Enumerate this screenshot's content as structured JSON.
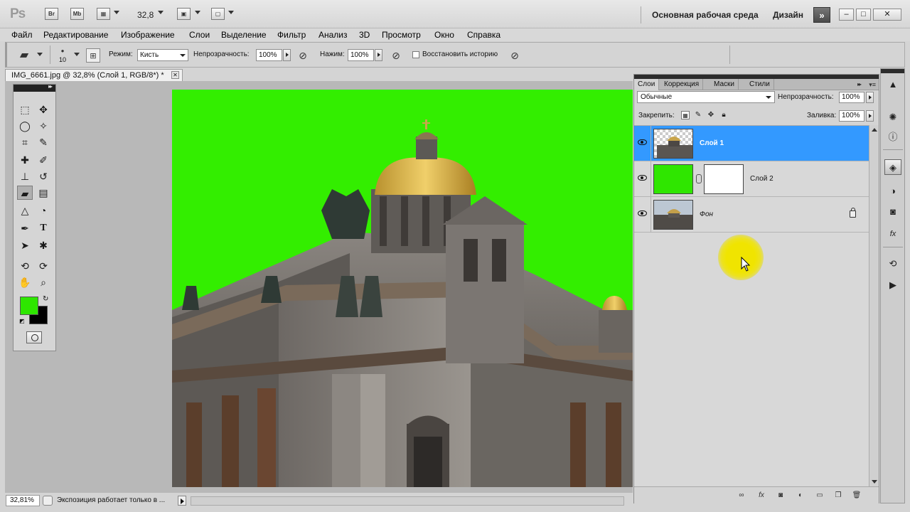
{
  "app": {
    "logo": "Ps",
    "bridge_btn": "Br",
    "minibridge_btn": "Mb",
    "zoom": "32,8",
    "workspace": "Основная рабочая среда",
    "design": "Дизайн",
    "more_btn": "»"
  },
  "window_controls": {
    "minimize": "–",
    "maximize": "□",
    "close": "✕"
  },
  "menu": [
    "Файл",
    "Редактирование",
    "Изображение",
    "Слои",
    "Выделение",
    "Фильтр",
    "Анализ",
    "3D",
    "Просмотр",
    "Окно",
    "Справка"
  ],
  "options": {
    "brush_size": "10",
    "mode_label": "Режим:",
    "mode_value": "Кисть",
    "opacity_label": "Непрозрачность:",
    "opacity_value": "100%",
    "flow_label": "Нажим:",
    "flow_value": "100%",
    "restore_history_label": "Восстановить историю",
    "restore_history_checked": false
  },
  "document": {
    "tab_title": "IMG_6661.jpg @ 32,8% (Слой 1, RGB/8*) *",
    "close": "✕",
    "background_color": "#33ee00"
  },
  "toolbox": {
    "foreground_color": "#2ee600",
    "background_color": "#000000",
    "tools": [
      {
        "name": "marquee-tool-icon",
        "glyph": "⬚"
      },
      {
        "name": "move-tool-icon",
        "glyph": "✥"
      },
      {
        "name": "lasso-tool-icon",
        "glyph": "◯"
      },
      {
        "name": "magic-wand-tool-icon",
        "glyph": "✧"
      },
      {
        "name": "crop-tool-icon",
        "glyph": "⌗"
      },
      {
        "name": "eyedropper-tool-icon",
        "glyph": "✎"
      },
      {
        "name": "healing-brush-tool-icon",
        "glyph": "✚"
      },
      {
        "name": "brush-tool-icon",
        "glyph": "✐"
      },
      {
        "name": "clone-stamp-tool-icon",
        "glyph": "⊥"
      },
      {
        "name": "history-brush-tool-icon",
        "glyph": "↺"
      },
      {
        "name": "eraser-tool-icon",
        "glyph": "▰"
      },
      {
        "name": "gradient-tool-icon",
        "glyph": "▤"
      },
      {
        "name": "blur-tool-icon",
        "glyph": "△"
      },
      {
        "name": "dodge-tool-icon",
        "glyph": "◔"
      },
      {
        "name": "pen-tool-icon",
        "glyph": "✒"
      },
      {
        "name": "type-tool-icon",
        "glyph": "T"
      },
      {
        "name": "path-selection-tool-icon",
        "glyph": "➤"
      },
      {
        "name": "custom-shape-tool-icon",
        "glyph": "✱"
      },
      {
        "name": "3d-rotate-tool-icon",
        "glyph": "⟲"
      },
      {
        "name": "3d-orbit-tool-icon",
        "glyph": "⟳"
      },
      {
        "name": "hand-tool-icon",
        "glyph": "✋"
      },
      {
        "name": "zoom-tool-icon",
        "glyph": "⌕"
      }
    ]
  },
  "status": {
    "zoom": "32,81%",
    "text": "Экспозиция работает только в ..."
  },
  "layers_panel": {
    "tabs": [
      "Слои",
      "Коррекция",
      "Маски",
      "Стили"
    ],
    "active_tab": "Слои",
    "blend_mode": "Обычные",
    "opacity_label": "Непрозрачность:",
    "opacity_value": "100%",
    "lock_label": "Закрепить:",
    "fill_label": "Заливка:",
    "fill_value": "100%",
    "selected_color": "#3399ff",
    "layers": [
      {
        "name": "Слой 1",
        "selected": true,
        "thumb": "checker",
        "has_mask": false,
        "locked": false,
        "italic": false
      },
      {
        "name": "Слой 2",
        "selected": false,
        "thumb": "green",
        "has_mask": true,
        "locked": false,
        "italic": false
      },
      {
        "name": "Фон",
        "selected": false,
        "thumb": "photo",
        "has_mask": false,
        "locked": true,
        "italic": true
      }
    ]
  },
  "dock": {
    "icons": [
      "histogram-icon",
      "navigator-icon",
      "info-icon",
      "layers-icon",
      "adjustments-icon",
      "masks-icon",
      "styles-icon",
      "history-icon",
      "actions-icon"
    ]
  }
}
